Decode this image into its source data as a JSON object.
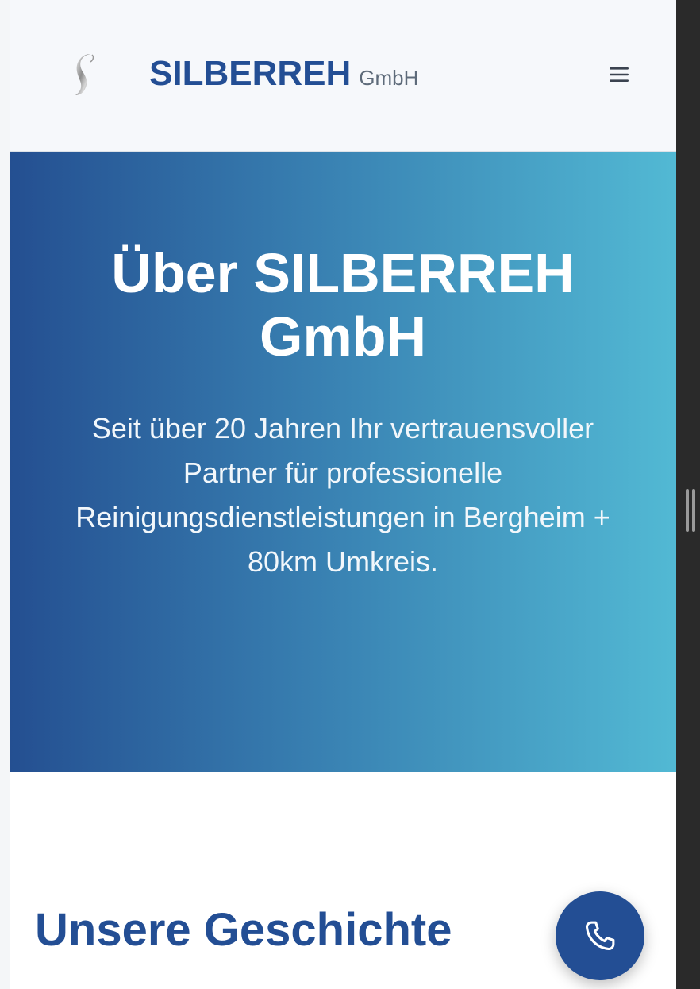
{
  "header": {
    "brand_name": "SILBERREH",
    "brand_suffix": "GmbH",
    "logo_icon": "silver-s-logo",
    "menu_icon": "hamburger-menu-icon"
  },
  "hero": {
    "title": "Über SILBERREH GmbH",
    "text": "Seit über 20 Jahren Ihr vertrauensvoller Partner für professionelle Reinigungsdienstleistungen in Bergheim + 80km Umkreis."
  },
  "story": {
    "title": "Unsere Geschichte"
  },
  "call_button": {
    "icon": "phone-icon"
  },
  "colors": {
    "brand_blue": "#234e94",
    "hero_gradient_start": "#244f91",
    "hero_gradient_end": "#52b9d4",
    "header_bg": "#f6f8fb"
  }
}
